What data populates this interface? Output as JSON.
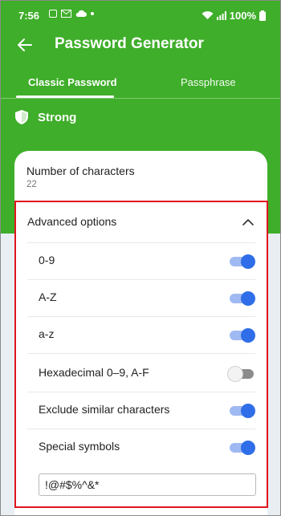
{
  "status_bar": {
    "time": "7:56",
    "battery": "100%",
    "icons": [
      "image-icon",
      "mail-icon",
      "cloud-icon",
      "dot-icon",
      "wifi-icon",
      "signal-icon",
      "battery-icon"
    ]
  },
  "app_bar": {
    "title": "Password Generator",
    "back_icon": "arrow-left-icon"
  },
  "tabs": [
    {
      "label": "Classic Password",
      "active": true
    },
    {
      "label": "Passphrase",
      "active": false
    }
  ],
  "strength": {
    "label": "Strong",
    "icon": "shield-icon"
  },
  "number_of_characters": {
    "label": "Number of characters",
    "value": "22"
  },
  "advanced": {
    "title": "Advanced options",
    "expanded": true,
    "options": [
      {
        "label": "0-9",
        "enabled": true
      },
      {
        "label": "A-Z",
        "enabled": true
      },
      {
        "label": "a-z",
        "enabled": true
      },
      {
        "label": "Hexadecimal 0–9, A-F",
        "enabled": false
      },
      {
        "label": "Exclude similar characters",
        "enabled": true
      },
      {
        "label": "Special symbols",
        "enabled": true
      }
    ],
    "symbols_value": "!@#$%^&*"
  },
  "colors": {
    "brand_green": "#3fae2a",
    "toggle_on": "#2f6ee8",
    "highlight_border": "#e0141e"
  }
}
